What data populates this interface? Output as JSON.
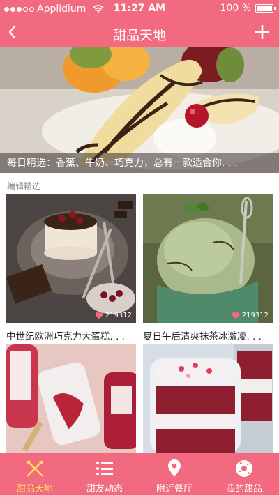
{
  "status_bar": {
    "carrier": "Applidium",
    "time": "11:27 AM",
    "battery": "100 %",
    "battery_level": 1.0
  },
  "nav": {
    "title": "甜品天地",
    "back_icon": "chevron-left-icon",
    "add_icon": "plus-icon"
  },
  "hero": {
    "caption": "每日精选：香蕉、牛奶、巧克力，总有一款适合你. . ."
  },
  "section": {
    "label": "编辑精选"
  },
  "cards": [
    {
      "title": "中世纪欧洲巧克力大蛋糕. . .",
      "likes": "219312"
    },
    {
      "title": "夏日午后清爽抹茶冰激凌. . .",
      "likes": "219312"
    },
    {
      "title": "",
      "likes": ""
    },
    {
      "title": "",
      "likes": ""
    }
  ],
  "tabs": [
    {
      "label": "甜品天地",
      "icon": "fork-knife-icon",
      "active": true
    },
    {
      "label": "甜友动态",
      "icon": "list-icon",
      "active": false
    },
    {
      "label": "附近餐厅",
      "icon": "location-pin-icon",
      "active": false
    },
    {
      "label": "我的甜品",
      "icon": "donut-icon",
      "active": false
    }
  ],
  "colors": {
    "brand": "#f26a7f",
    "active_tab": "#ffe15a",
    "like_heart": "#f26a7f"
  }
}
